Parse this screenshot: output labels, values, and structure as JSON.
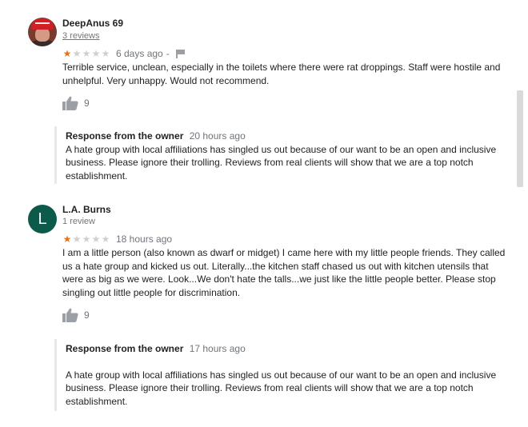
{
  "reviews": [
    {
      "author": "DeepAnus 69",
      "review_count": "3 reviews",
      "rating": 1,
      "time": "6 days ago",
      "separator": "-",
      "text": "Terrible service, unclean, especially in the toilets where there were rat droppings. Staff were hostile and unhelpful. Very unhappy. Would not recommend.",
      "likes": "9",
      "owner_response": {
        "label": "Response from the owner",
        "time": "20 hours ago",
        "text": "A hate group with local affiliations has singled us out because of our want to be an open and inclusive business. Please ignore their trolling. Reviews from real clients will show that we are a top notch establishment."
      }
    },
    {
      "author": "L.A. Burns",
      "avatar_letter": "L",
      "review_count": "1 review",
      "rating": 1,
      "time": "18 hours ago",
      "text": "I am a little person (also known as dwarf or midget) I came here with my little people friends. They called us a hate group and kicked us out. Literally...the kitchen staff chased us out with kitchen utensils that were as big as we were. Look...We don't hate the talls...we just like the little people better. Please stop singling out little people for discrimination.",
      "likes": "9",
      "owner_response": {
        "label": "Response from the owner",
        "time": "17 hours ago",
        "text": "A hate group with local affiliations has singled us out because of our want to be an open and inclusive business. Please ignore their trolling. Reviews from real clients will show that we are a top notch establishment."
      }
    }
  ],
  "colors": {
    "star_filled": "#e7711b",
    "star_empty": "#d0d0d0",
    "avatar_lb": "#0b5a4a",
    "secondary_text": "#70757a"
  },
  "icons": {
    "thumb": "thumbs-up-icon",
    "flag": "flag-icon"
  }
}
